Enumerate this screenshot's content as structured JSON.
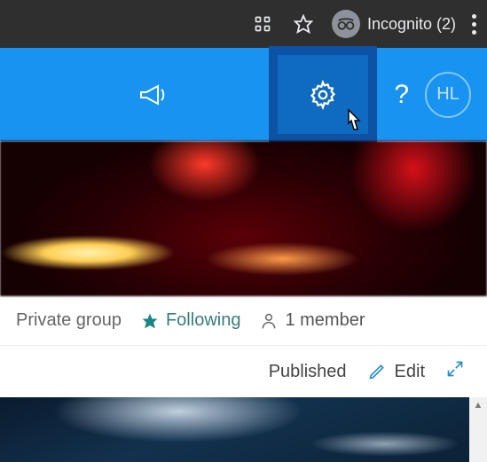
{
  "browser": {
    "incognito_label": "Incognito (2)"
  },
  "suite": {
    "avatar_initials": "HL"
  },
  "page_info": {
    "group_type": "Private group",
    "follow_label": "Following",
    "members_label": "1 member"
  },
  "actions": {
    "status": "Published",
    "edit_label": "Edit"
  }
}
